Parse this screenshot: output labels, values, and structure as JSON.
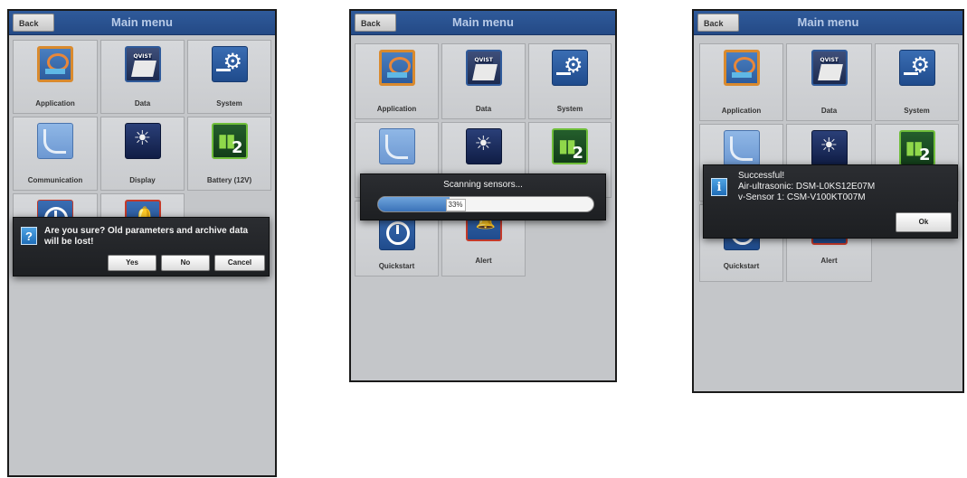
{
  "screens": [
    {
      "back_label": "Back",
      "title": "Main menu",
      "tiles": [
        {
          "label": "Application",
          "icon": "application-icon"
        },
        {
          "label": "Data",
          "icon": "data-icon"
        },
        {
          "label": "System",
          "icon": "system-icon"
        },
        {
          "label": "Communication",
          "icon": "communication-icon"
        },
        {
          "label": "Display",
          "icon": "display-icon"
        },
        {
          "label": "Battery (12V)",
          "icon": "battery-icon"
        }
      ],
      "dialog": {
        "message": "Are you sure? Old parameters and archive data will be lost!",
        "buttons": [
          "Yes",
          "No",
          "Cancel"
        ]
      }
    },
    {
      "back_label": "Back",
      "title": "Main menu",
      "tiles": [
        {
          "label": "Application",
          "icon": "application-icon"
        },
        {
          "label": "Data",
          "icon": "data-icon"
        },
        {
          "label": "System",
          "icon": "system-icon"
        },
        {
          "label": "",
          "icon": "communication-icon"
        },
        {
          "label": "",
          "icon": "display-icon"
        },
        {
          "label": "",
          "icon": "battery-icon"
        },
        {
          "label": "Quickstart",
          "icon": "quickstart-icon"
        },
        {
          "label": "Alert",
          "icon": "alert-icon"
        }
      ],
      "progress": {
        "message": "Scanning sensors...",
        "value_text": "33%",
        "value": 33
      }
    },
    {
      "back_label": "Back",
      "title": "Main menu",
      "tiles": [
        {
          "label": "Application",
          "icon": "application-icon"
        },
        {
          "label": "Data",
          "icon": "data-icon"
        },
        {
          "label": "System",
          "icon": "system-icon"
        },
        {
          "label": "",
          "icon": "communication-icon"
        },
        {
          "label": "",
          "icon": "display-icon"
        },
        {
          "label": "",
          "icon": "battery-icon"
        },
        {
          "label": "Quickstart",
          "icon": "quickstart-icon"
        },
        {
          "label": "Alert",
          "icon": "alert-icon"
        }
      ],
      "dialog": {
        "line1": "Successful!",
        "line2": "Air-ultrasonic: DSM-L0KS12E07M",
        "line3": "v-Sensor 1: CSM-V100KT007M",
        "ok_label": "Ok"
      }
    }
  ]
}
